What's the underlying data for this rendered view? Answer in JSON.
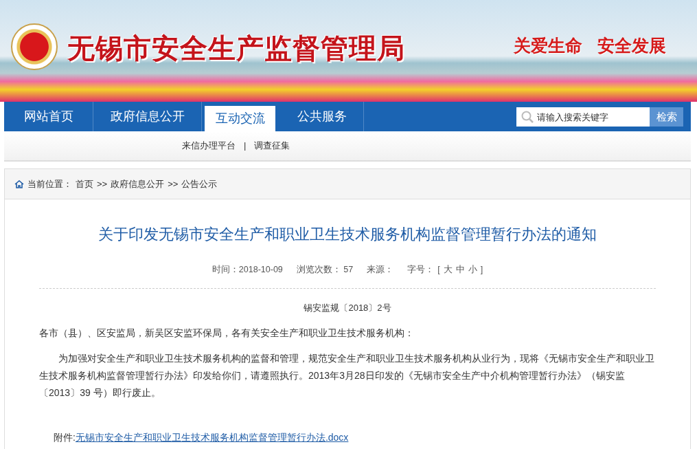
{
  "header": {
    "site_title": "无锡市安全生产监督管理局",
    "slogan": [
      "关爱生命",
      "安全发展"
    ]
  },
  "nav": {
    "tabs": [
      {
        "label": "网站首页",
        "selected": false
      },
      {
        "label": "政府信息公开",
        "selected": false
      },
      {
        "label": "互动交流",
        "selected": true
      },
      {
        "label": "公共服务",
        "selected": false
      }
    ],
    "search": {
      "placeholder": "请输入搜索关键字",
      "button": "检索"
    }
  },
  "subnav": {
    "links": [
      "来信办理平台",
      "调查征集"
    ],
    "separator": "|"
  },
  "breadcrumb": {
    "label": "当前位置：",
    "items": [
      "首页",
      "政府信息公开",
      "公告公示"
    ],
    "separator": ">>"
  },
  "article": {
    "title": "关于印发无锡市安全生产和职业卫生技术服务机构监督管理暂行办法的通知",
    "meta": {
      "time": "时间：2018-10-09",
      "views": "浏览次数： 57",
      "source": "来源：",
      "font_size_label": "字号：",
      "font_sizes": [
        "[",
        "大",
        "中",
        "小",
        "]"
      ]
    },
    "doc_number": "锡安监规〔2018〕2号",
    "salutation": "各市（县）、区安监局，新吴区安监环保局，各有关安全生产和职业卫生技术服务机构：",
    "body": [
      "为加强对安全生产和职业卫生技术服务机构的监督和管理，规范安全生产和职业卫生技术服务机构从业行为，现将《无锡市安全生产和职业卫生技术服务机构监督管理暂行办法》印发给你们，请遵照执行。2013年3月28日印发的《无锡市安全生产中介机构管理暂行办法》（锡安监〔2013〕39 号）即行废止。"
    ],
    "attachment": {
      "label": "附件:",
      "link": "无锡市安全生产和职业卫生技术服务机构监督管理暂行办法.docx"
    }
  }
}
